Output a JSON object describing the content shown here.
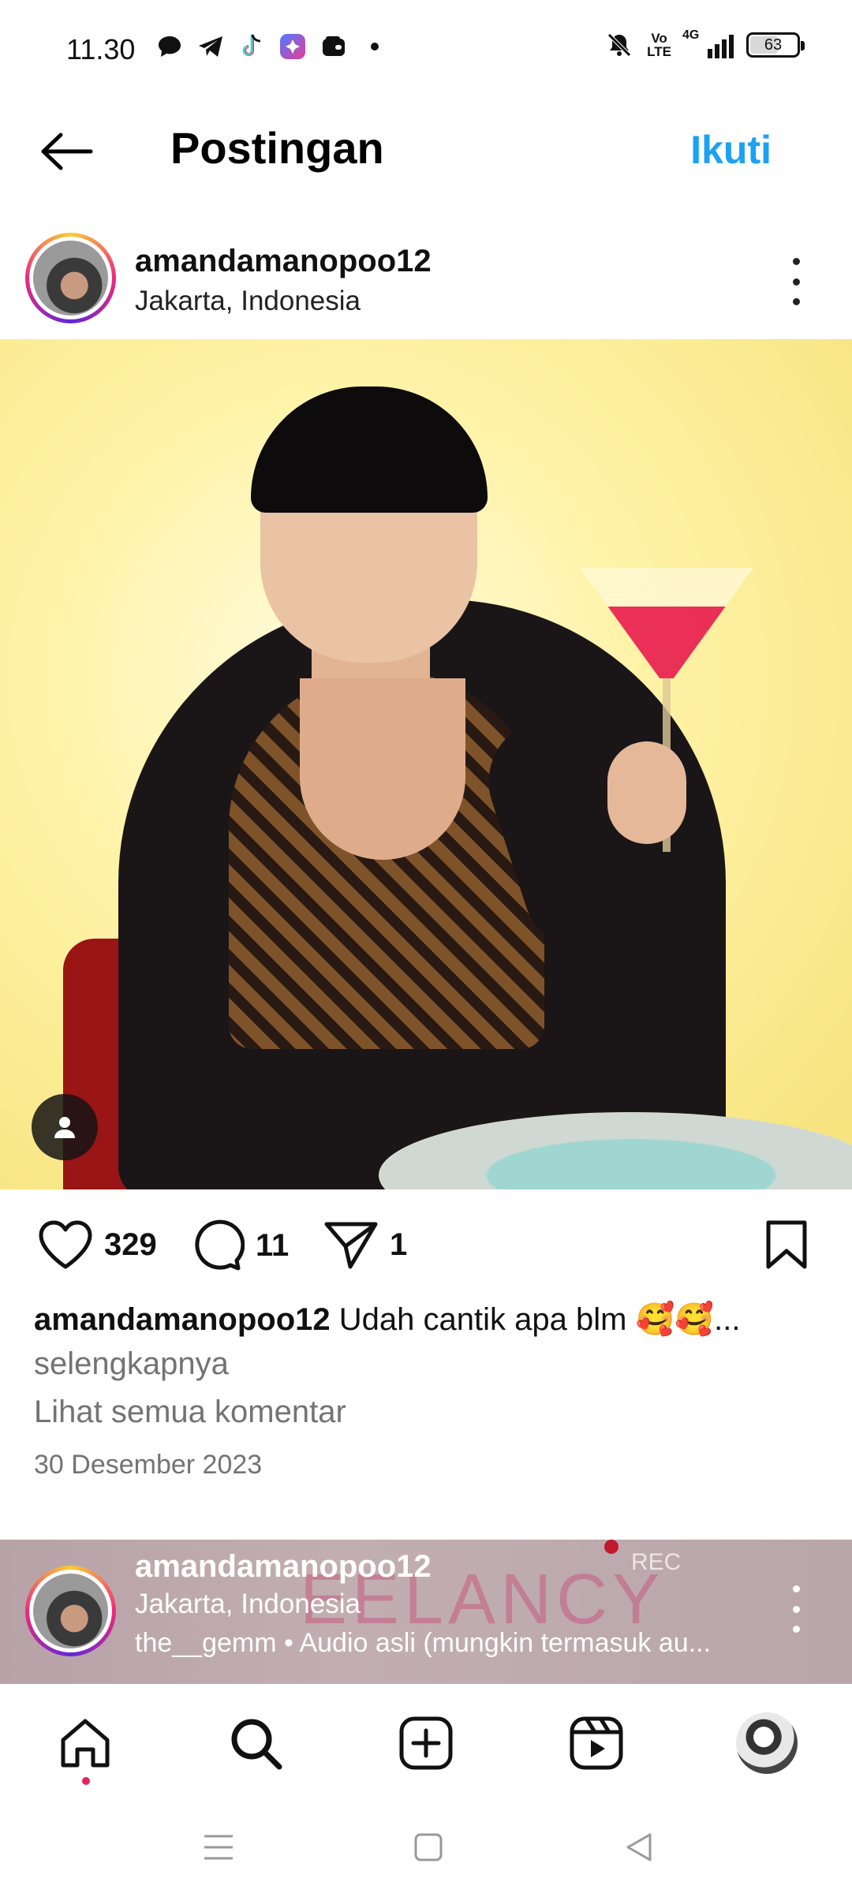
{
  "status_bar": {
    "time": "11.30",
    "network": "4G",
    "volte_line1": "Vo",
    "volte_line2": "LTE",
    "battery_level": 63,
    "battery_text": "63",
    "icons": [
      "chat-bubble-icon",
      "telegram-icon",
      "tiktok-icon",
      "app-icon",
      "wallet-icon",
      "more-dot-icon",
      "bell-off-icon",
      "signal-icon"
    ]
  },
  "header": {
    "title": "Postingan",
    "follow_label": "Ikuti",
    "back_icon": "arrow-left-icon"
  },
  "post": {
    "username": "amandamanopoo12",
    "location": "Jakarta, Indonesia",
    "likes": "329",
    "comments": "11",
    "shares": "1",
    "caption_text": "Udah cantik apa blm 🥰🥰...",
    "more_label": "selengkapnya",
    "view_comments": "Lihat semua komentar",
    "date": "30 Desember 2023"
  },
  "next_post": {
    "username": "amandamanopoo12",
    "location": "Jakarta, Indonesia",
    "audio": "the__gemm • Audio asli (mungkin termasuk au...",
    "bg_text": "EELANCY",
    "rec_label": "REC"
  },
  "bottom_nav": [
    "home-icon",
    "search-icon",
    "create-icon",
    "reels-icon",
    "profile-avatar"
  ],
  "system_nav": [
    "menu-icon",
    "home-square-icon",
    "back-triangle-icon"
  ],
  "colors": {
    "accent": "#1da1f2",
    "text": "#111111",
    "muted": "#737373",
    "notification_dot": "#e0245e"
  }
}
